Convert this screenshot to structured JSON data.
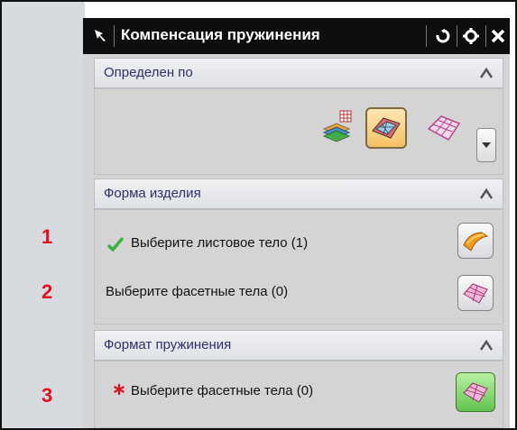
{
  "dialog": {
    "title": "Компенсация пружинения"
  },
  "markers": [
    "1",
    "2",
    "3"
  ],
  "sections": {
    "defined_by": {
      "title": "Определен по",
      "icons": [
        "layered-body-icon",
        "facet-surface-icon",
        "mesh-surface-icon"
      ],
      "selected_icon": "facet-surface-icon"
    },
    "product_shape": {
      "title": "Форма изделия",
      "row1_label": "Выберите листовое тело (1)",
      "row1_status": "check",
      "row2_label": "Выберите фасетные тела (0)"
    },
    "springback_format": {
      "title": "Формат пружинения",
      "row1_label": "Выберите фасетные тела (0)",
      "row1_status": "required"
    }
  },
  "colors": {
    "title_bg": "#0e0e0e",
    "marker_red": "#e3101c",
    "section_label": "#2f2f6b",
    "active_green": "#61c44d"
  }
}
